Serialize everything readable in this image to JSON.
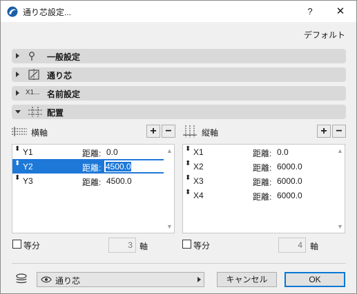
{
  "window": {
    "title": "通り芯設定...",
    "help_label": "?",
    "close_label": "✕",
    "default_link": "デフォルト"
  },
  "sections": [
    {
      "label": "一般設定",
      "icon_name": "pin-icon",
      "expanded": false
    },
    {
      "label": "通り芯",
      "icon_name": "grid-axis-icon",
      "expanded": false
    },
    {
      "label": "名前設定",
      "icon_text": "X1...",
      "icon_name": "naming-icon",
      "expanded": false
    },
    {
      "label": "配置",
      "icon_name": "placement-icon",
      "expanded": true
    }
  ],
  "horizontal": {
    "label": "横軸",
    "add_label": "+",
    "remove_label": "−",
    "rows": [
      {
        "name": "Y1",
        "dist_label": "距離:",
        "dist_value": "0.0",
        "selected": false
      },
      {
        "name": "Y2",
        "dist_label": "距離:",
        "dist_value": "4500.0",
        "selected": true
      },
      {
        "name": "Y3",
        "dist_label": "距離:",
        "dist_value": "4500.0",
        "selected": false
      }
    ],
    "equal_label": "等分",
    "count": "3",
    "unit": "軸"
  },
  "vertical": {
    "label": "縦軸",
    "add_label": "+",
    "remove_label": "−",
    "rows": [
      {
        "name": "X1",
        "dist_label": "距離:",
        "dist_value": "0.0"
      },
      {
        "name": "X2",
        "dist_label": "距離:",
        "dist_value": "6000.0"
      },
      {
        "name": "X3",
        "dist_label": "距離:",
        "dist_value": "6000.0"
      },
      {
        "name": "X4",
        "dist_label": "距離:",
        "dist_value": "6000.0"
      }
    ],
    "equal_label": "等分",
    "count": "4",
    "unit": "軸"
  },
  "footer": {
    "layer_value": "通り芯",
    "cancel_label": "キャンセル",
    "ok_label": "OK"
  },
  "colors": {
    "selection": "#1e78d7",
    "section_bar": "#d9d9d9",
    "dialog_bg": "#f0f0f0"
  }
}
